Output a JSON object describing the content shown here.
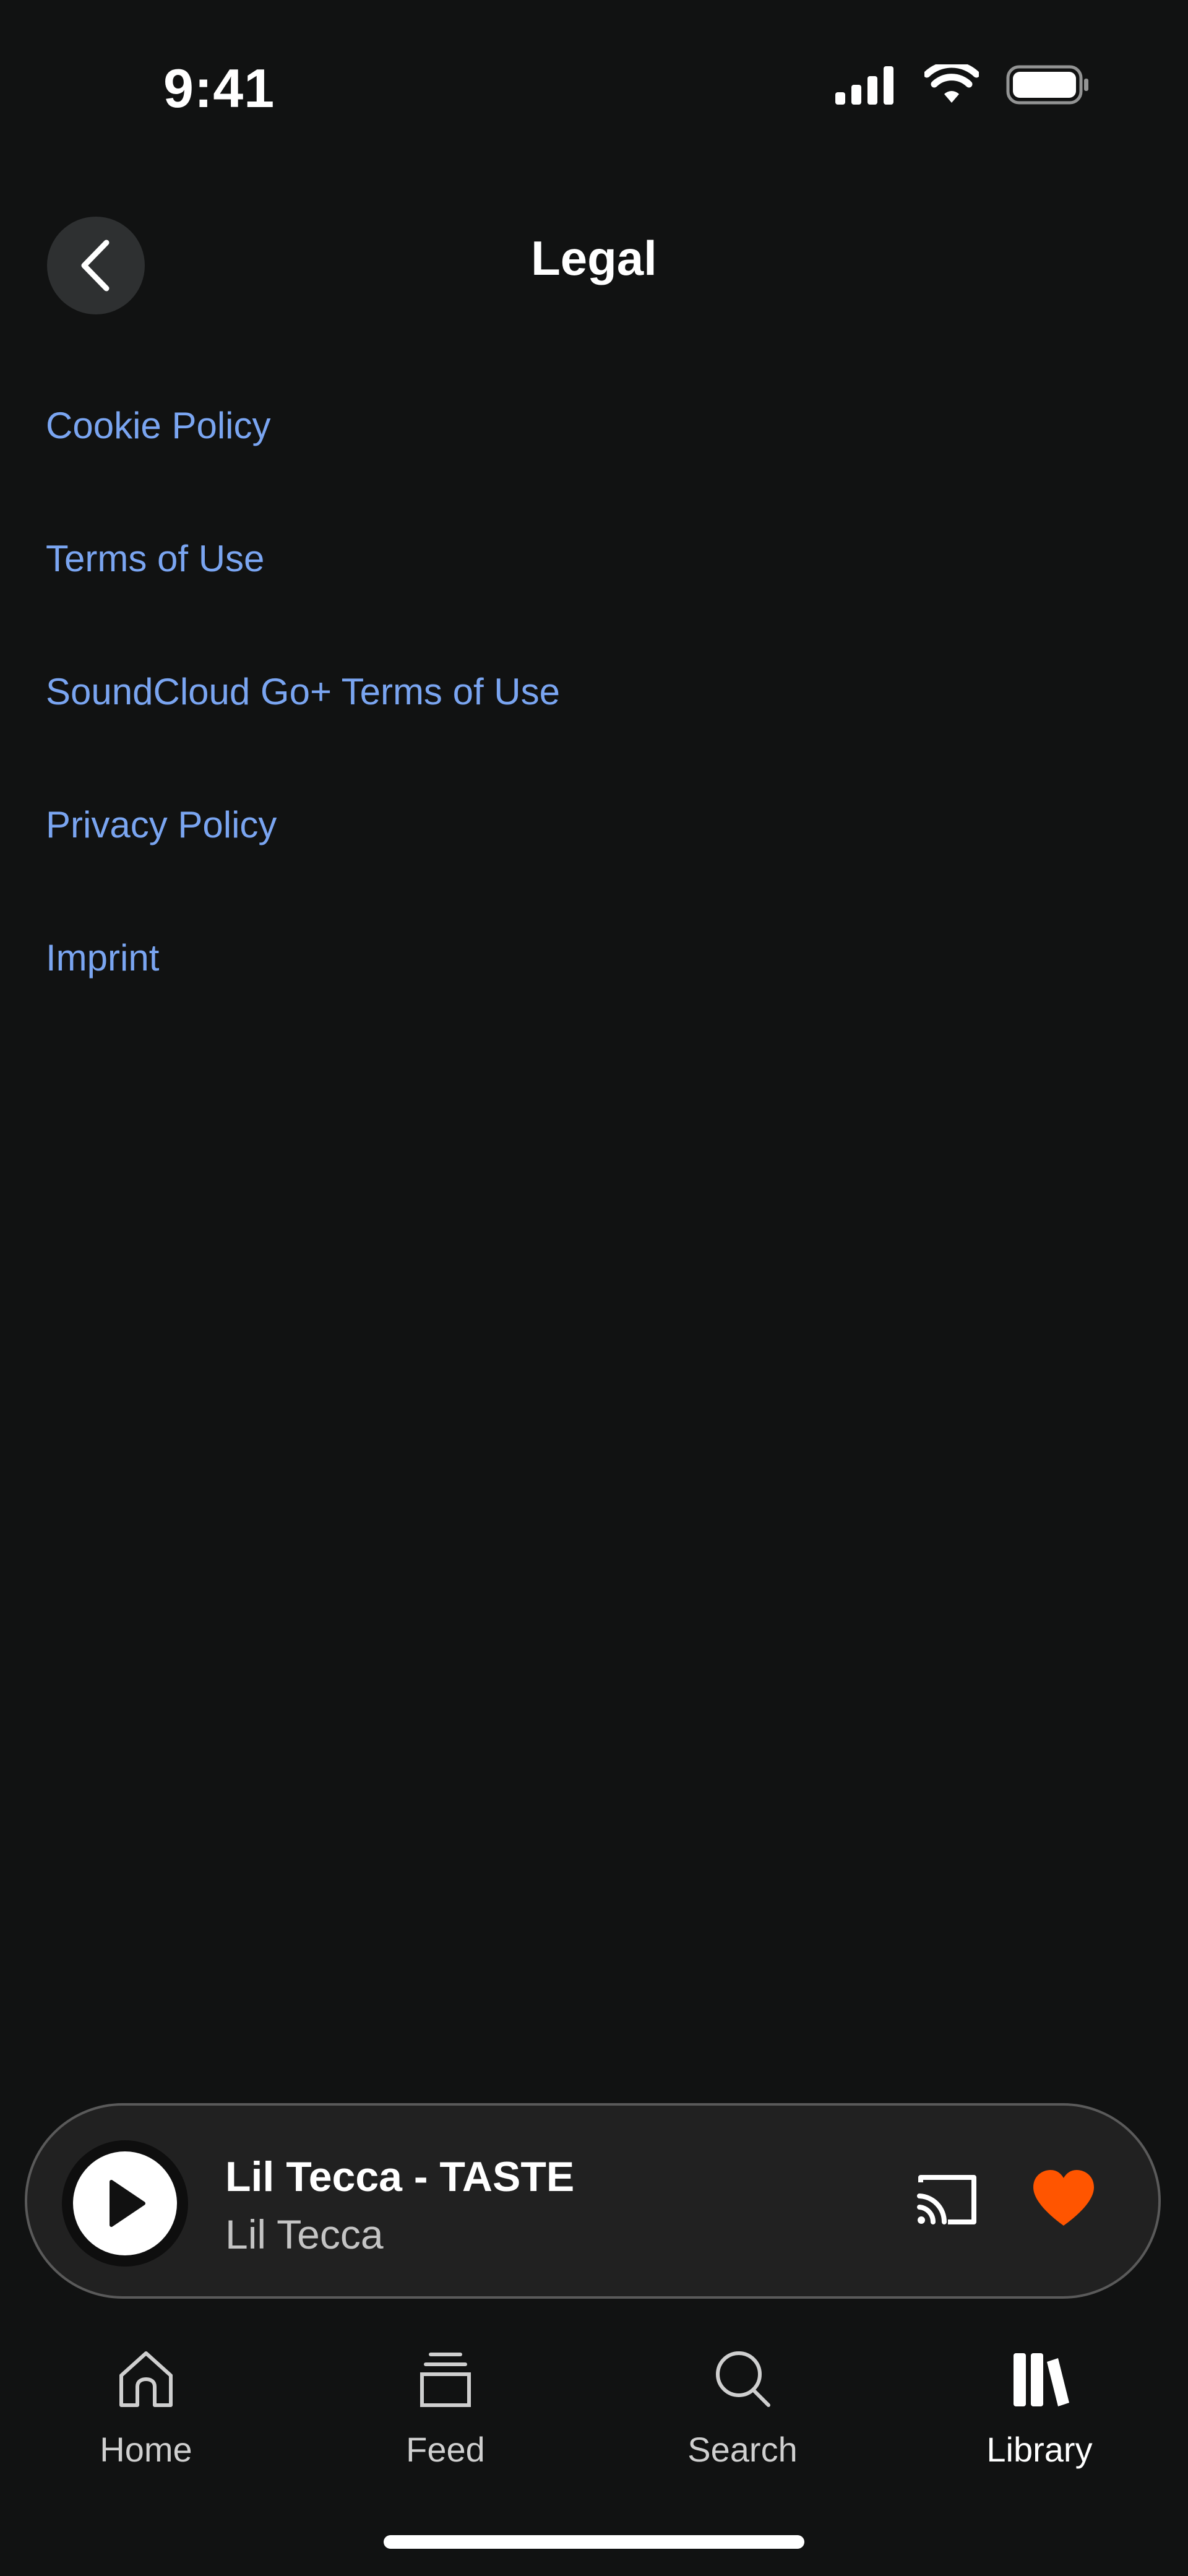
{
  "status_bar": {
    "time": "9:41"
  },
  "header": {
    "title": "Legal"
  },
  "links": [
    {
      "label": "Cookie Policy"
    },
    {
      "label": "Terms of Use"
    },
    {
      "label": "SoundCloud Go+ Terms of Use"
    },
    {
      "label": "Privacy Policy"
    },
    {
      "label": "Imprint"
    }
  ],
  "mini_player": {
    "track_title": "Lil Tecca - TASTE",
    "artist": "Lil Tecca",
    "liked": true
  },
  "tab_bar": {
    "items": [
      {
        "label": "Home",
        "icon": "home-icon",
        "active": false
      },
      {
        "label": "Feed",
        "icon": "feed-icon",
        "active": false
      },
      {
        "label": "Search",
        "icon": "search-icon",
        "active": false
      },
      {
        "label": "Library",
        "icon": "library-icon",
        "active": true
      }
    ]
  },
  "colors": {
    "background": "#111212",
    "link": "#7aa5f1",
    "accent_like": "#ff5500",
    "player_bg": "#212121"
  }
}
